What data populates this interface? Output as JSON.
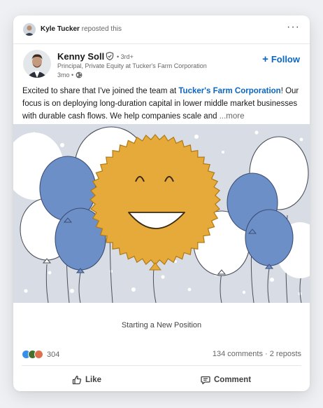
{
  "repost": {
    "name": "Kyle Tucker",
    "suffix": "reposted this",
    "more_glyph": "···"
  },
  "author": {
    "name": "Kenny Soll",
    "degree": "• 3rd+",
    "headline": "Principal, Private Equity at Tucker's Farm Corporation",
    "time": "3mo •"
  },
  "follow": {
    "plus": "+",
    "label": "Follow"
  },
  "post": {
    "text_before": "Excited to share that I've joined the team at ",
    "company_link": "Tucker's Farm Corporation",
    "text_after": "! Our focus is on deploying long-duration capital in lower middle market businesses with durable cash flows. We help companies scale and ",
    "see_more": "...more"
  },
  "caption": "Starting a New Position",
  "social": {
    "reaction_count": "304",
    "comments_reposts": "134 comments · 2 reposts"
  },
  "actions": {
    "like_label": "Like",
    "comment_label": "Comment"
  },
  "colors": {
    "accent": "#0a66c2",
    "balloon_blue": "#6d8fc8",
    "sun_gold": "#e6aa3a",
    "background": "#d7dce5"
  }
}
